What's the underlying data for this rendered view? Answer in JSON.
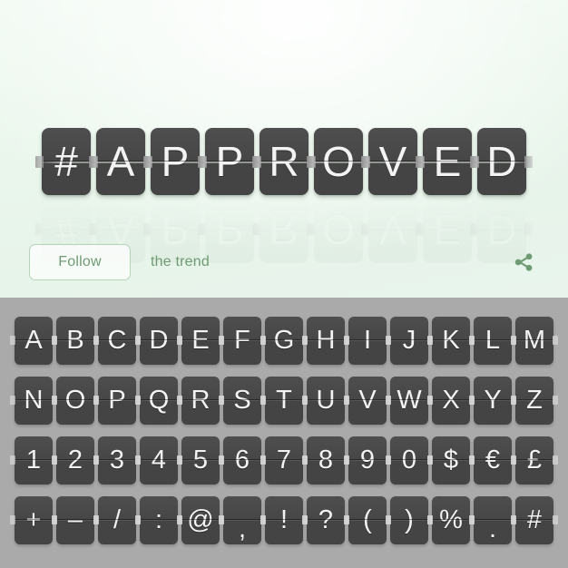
{
  "hero": {
    "word": "#APPROVED",
    "characters": [
      "#",
      "A",
      "P",
      "P",
      "R",
      "O",
      "V",
      "E",
      "D"
    ],
    "background_gradient_from": "#f2faf3",
    "background_gradient_to": "#e7f4ea",
    "tile_color": "#444444",
    "tile_text_color": "#f3f3f3"
  },
  "actions": {
    "follow_label": "Follow",
    "caption": "the trend",
    "share_icon": "share-icon",
    "accent_color": "#6f9b74",
    "border_color": "#b6d2b8"
  },
  "sheet": {
    "background_color": "#aaaaaa",
    "rows": [
      {
        "name": "letters-a-m",
        "characters": [
          "A",
          "B",
          "C",
          "D",
          "E",
          "F",
          "G",
          "H",
          "I",
          "J",
          "K",
          "L",
          "M"
        ]
      },
      {
        "name": "letters-n-z",
        "characters": [
          "N",
          "O",
          "P",
          "Q",
          "R",
          "S",
          "T",
          "U",
          "V",
          "W",
          "X",
          "Y",
          "Z"
        ]
      },
      {
        "name": "digits-and-currency",
        "characters": [
          "1",
          "2",
          "3",
          "4",
          "5",
          "6",
          "7",
          "8",
          "9",
          "0",
          "$",
          "€",
          "£"
        ]
      },
      {
        "name": "punctuation",
        "characters": [
          "+",
          "–",
          "/",
          ":",
          "@",
          ",",
          "!",
          "?",
          "(",
          ")",
          "%",
          ".",
          "#"
        ]
      }
    ]
  }
}
